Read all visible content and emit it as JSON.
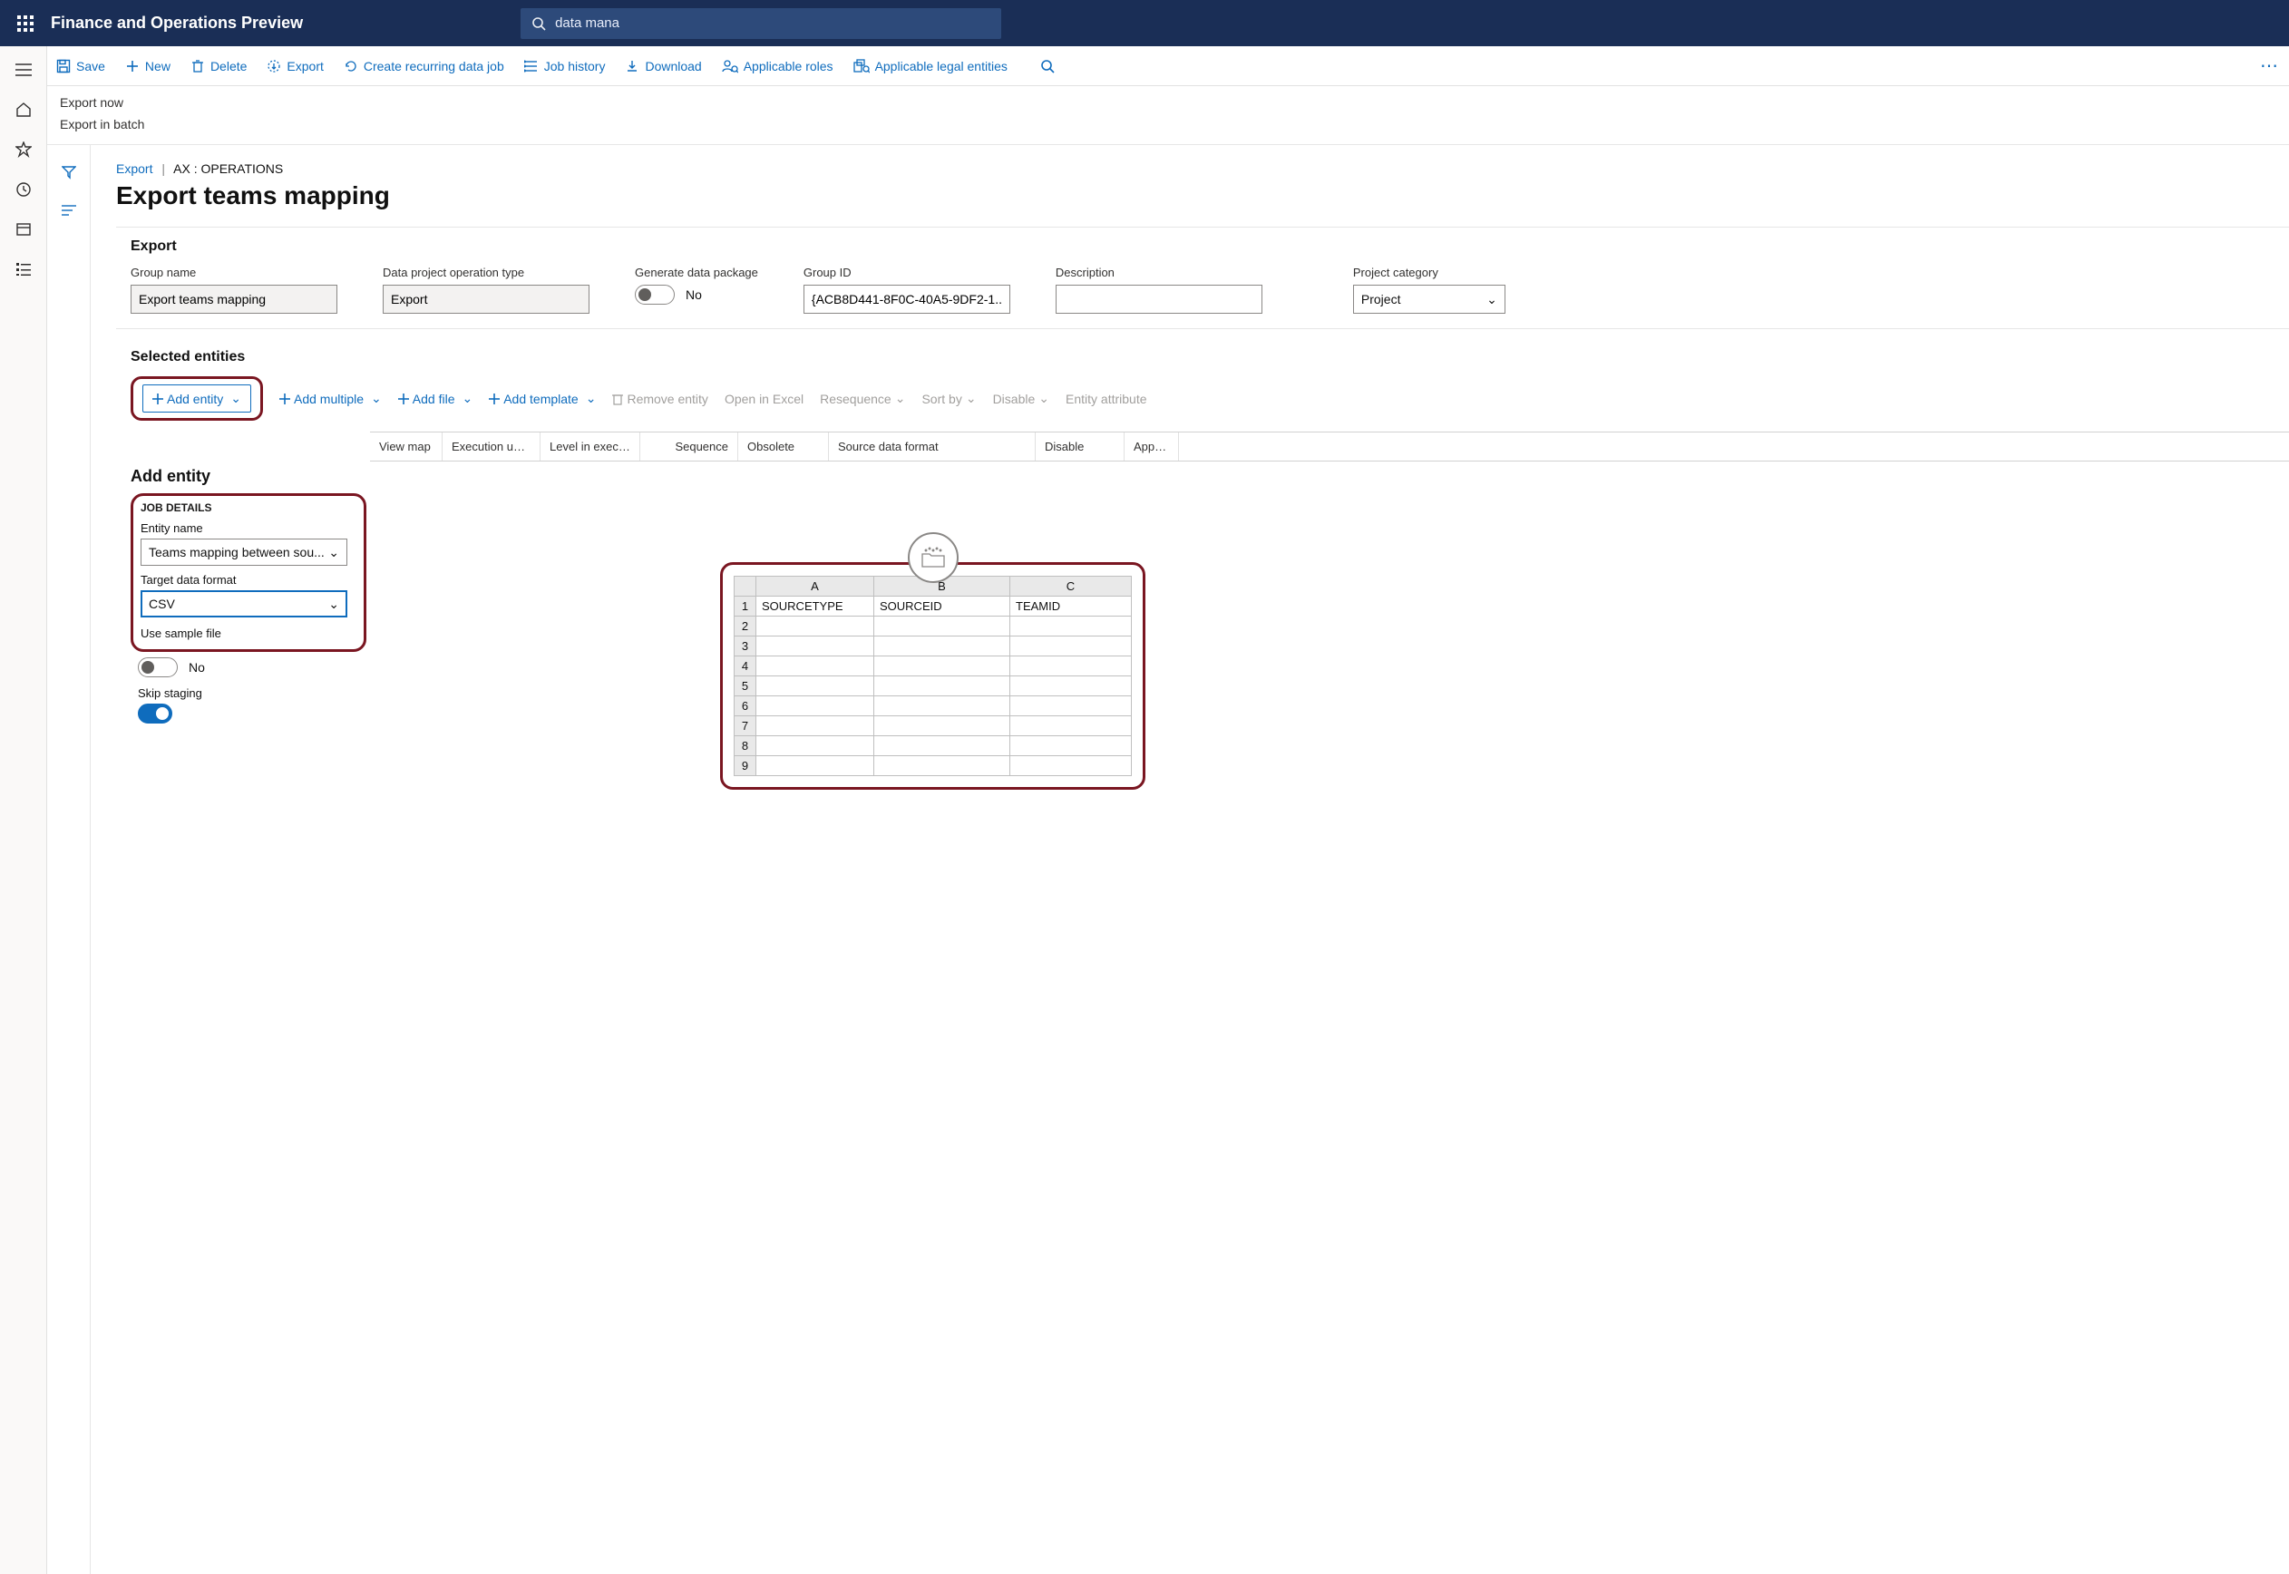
{
  "header": {
    "app_title": "Finance and Operations Preview",
    "search_text": "data mana"
  },
  "actions": {
    "save": "Save",
    "new": "New",
    "delete": "Delete",
    "export": "Export",
    "recurring": "Create recurring data job",
    "history": "Job history",
    "download": "Download",
    "roles": "Applicable roles",
    "entities": "Applicable legal entities"
  },
  "export_options": {
    "now": "Export now",
    "batch": "Export in batch"
  },
  "crumb": {
    "export": "Export",
    "sep": "|",
    "context": "AX : OPERATIONS"
  },
  "page_title": "Export teams mapping",
  "section_export": {
    "title": "Export",
    "group_name_label": "Group name",
    "group_name": "Export teams mapping",
    "op_type_label": "Data project operation type",
    "op_type": "Export",
    "pkg_label": "Generate data package",
    "pkg_value": "No",
    "groupid_label": "Group ID",
    "groupid": "{ACB8D441-8F0C-40A5-9DF2-1...",
    "desc_label": "Description",
    "desc": "",
    "cat_label": "Project category",
    "cat": "Project"
  },
  "entities": {
    "title": "Selected entities",
    "add_entity": "Add entity",
    "add_multiple": "Add multiple",
    "add_file": "Add file",
    "add_template": "Add template",
    "remove": "Remove entity",
    "open_excel": "Open in Excel",
    "resequence": "Resequence",
    "sort_by": "Sort by",
    "disable": "Disable",
    "entity_attr": "Entity attribute"
  },
  "grid_cols": {
    "c1": "View map",
    "c2": "Execution unit",
    "c3": "Level in executi...",
    "c4": "Sequence",
    "c5": "Obsolete",
    "c6": "Source data format",
    "c7": "Disable",
    "c8": "Applicat"
  },
  "add_panel": {
    "title": "Add entity",
    "job_details": "JOB DETAILS",
    "entity_name_label": "Entity name",
    "entity_name": "Teams mapping between sou...",
    "target_fmt_label": "Target data format",
    "target_fmt": "CSV",
    "use_sample_label": "Use sample file",
    "use_sample_val": "No",
    "skip_staging_label": "Skip staging"
  },
  "excel": {
    "colA": "A",
    "colB": "B",
    "colC": "C",
    "h1": "SOURCETYPE",
    "h2": "SOURCEID",
    "h3": "TEAMID",
    "rows": [
      "1",
      "2",
      "3",
      "4",
      "5",
      "6",
      "7",
      "8",
      "9"
    ]
  }
}
